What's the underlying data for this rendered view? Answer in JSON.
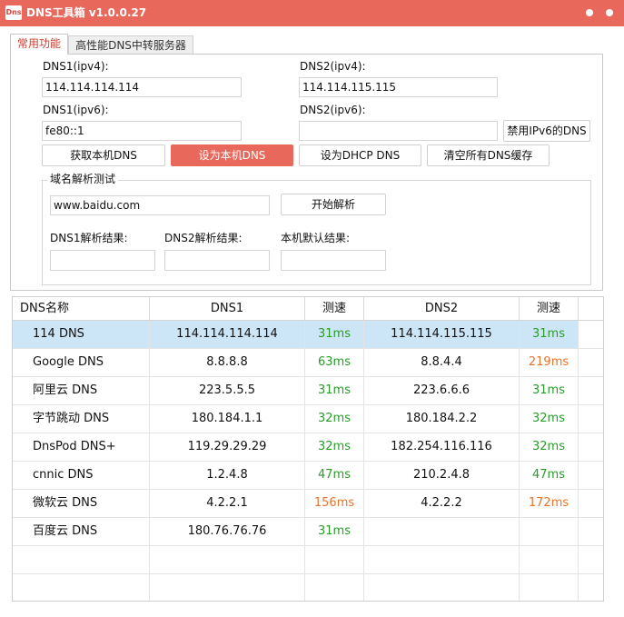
{
  "window": {
    "icon_text": "Dns",
    "title": "DNS工具箱 v1.0.0.27"
  },
  "tabs": [
    {
      "label": "常用功能",
      "active": true
    },
    {
      "label": "高性能DNS中转服务器",
      "active": false
    }
  ],
  "form": {
    "dns1_ipv4_label": "DNS1(ipv4):",
    "dns1_ipv4_value": "114.114.114.114",
    "dns2_ipv4_label": "DNS2(ipv4):",
    "dns2_ipv4_value": "114.114.115.115",
    "dns1_ipv6_label": "DNS1(ipv6):",
    "dns1_ipv6_value": "fe80::1",
    "dns2_ipv6_label": "DNS2(ipv6):",
    "dns2_ipv6_value": "",
    "disable_ipv6_dns": "禁用IPv6的DNS"
  },
  "actions": {
    "get_local_dns": "获取本机DNS",
    "set_local_dns": "设为本机DNS",
    "set_dhcp_dns": "设为DHCP DNS",
    "clear_dns_cache": "清空所有DNS缓存"
  },
  "resolve_test": {
    "group_title": "域名解析测试",
    "domain_value": "www.baidu.com",
    "start_button": "开始解析",
    "dns1_result_label": "DNS1解析结果:",
    "dns2_result_label": "DNS2解析结果:",
    "local_result_label": "本机默认结果:",
    "dns1_result": "",
    "dns2_result": "",
    "local_result": ""
  },
  "table": {
    "headers": [
      "DNS名称",
      "DNS1",
      "测速",
      "DNS2",
      "测速"
    ],
    "rows": [
      {
        "name": "114 DNS",
        "dns1": "114.114.114.114",
        "speed1": "31ms",
        "speed1_color": "green",
        "dns2": "114.114.115.115",
        "speed2": "31ms",
        "speed2_color": "green",
        "selected": true
      },
      {
        "name": "Google DNS",
        "dns1": "8.8.8.8",
        "speed1": "63ms",
        "speed1_color": "green",
        "dns2": "8.8.4.4",
        "speed2": "219ms",
        "speed2_color": "orange",
        "selected": false
      },
      {
        "name": "阿里云 DNS",
        "dns1": "223.5.5.5",
        "speed1": "31ms",
        "speed1_color": "green",
        "dns2": "223.6.6.6",
        "speed2": "31ms",
        "speed2_color": "green",
        "selected": false
      },
      {
        "name": "字节跳动 DNS",
        "dns1": "180.184.1.1",
        "speed1": "32ms",
        "speed1_color": "green",
        "dns2": "180.184.2.2",
        "speed2": "32ms",
        "speed2_color": "green",
        "selected": false
      },
      {
        "name": "DnsPod DNS+",
        "dns1": "119.29.29.29",
        "speed1": "32ms",
        "speed1_color": "green",
        "dns2": "182.254.116.116",
        "speed2": "32ms",
        "speed2_color": "green",
        "selected": false
      },
      {
        "name": "cnnic DNS",
        "dns1": "1.2.4.8",
        "speed1": "47ms",
        "speed1_color": "green",
        "dns2": "210.2.4.8",
        "speed2": "47ms",
        "speed2_color": "green",
        "selected": false
      },
      {
        "name": "微软云 DNS",
        "dns1": "4.2.2.1",
        "speed1": "156ms",
        "speed1_color": "orange",
        "dns2": "4.2.2.2",
        "speed2": "172ms",
        "speed2_color": "orange",
        "selected": false
      },
      {
        "name": "百度云 DNS",
        "dns1": "180.76.76.76",
        "speed1": "31ms",
        "speed1_color": "green",
        "dns2": "",
        "speed2": "",
        "speed2_color": "green",
        "selected": false
      }
    ]
  },
  "colors": {
    "accent": "#e8695c",
    "selected_row": "#cde6f7",
    "speed_good": "#2a9a2a",
    "speed_slow": "#e8742d"
  }
}
